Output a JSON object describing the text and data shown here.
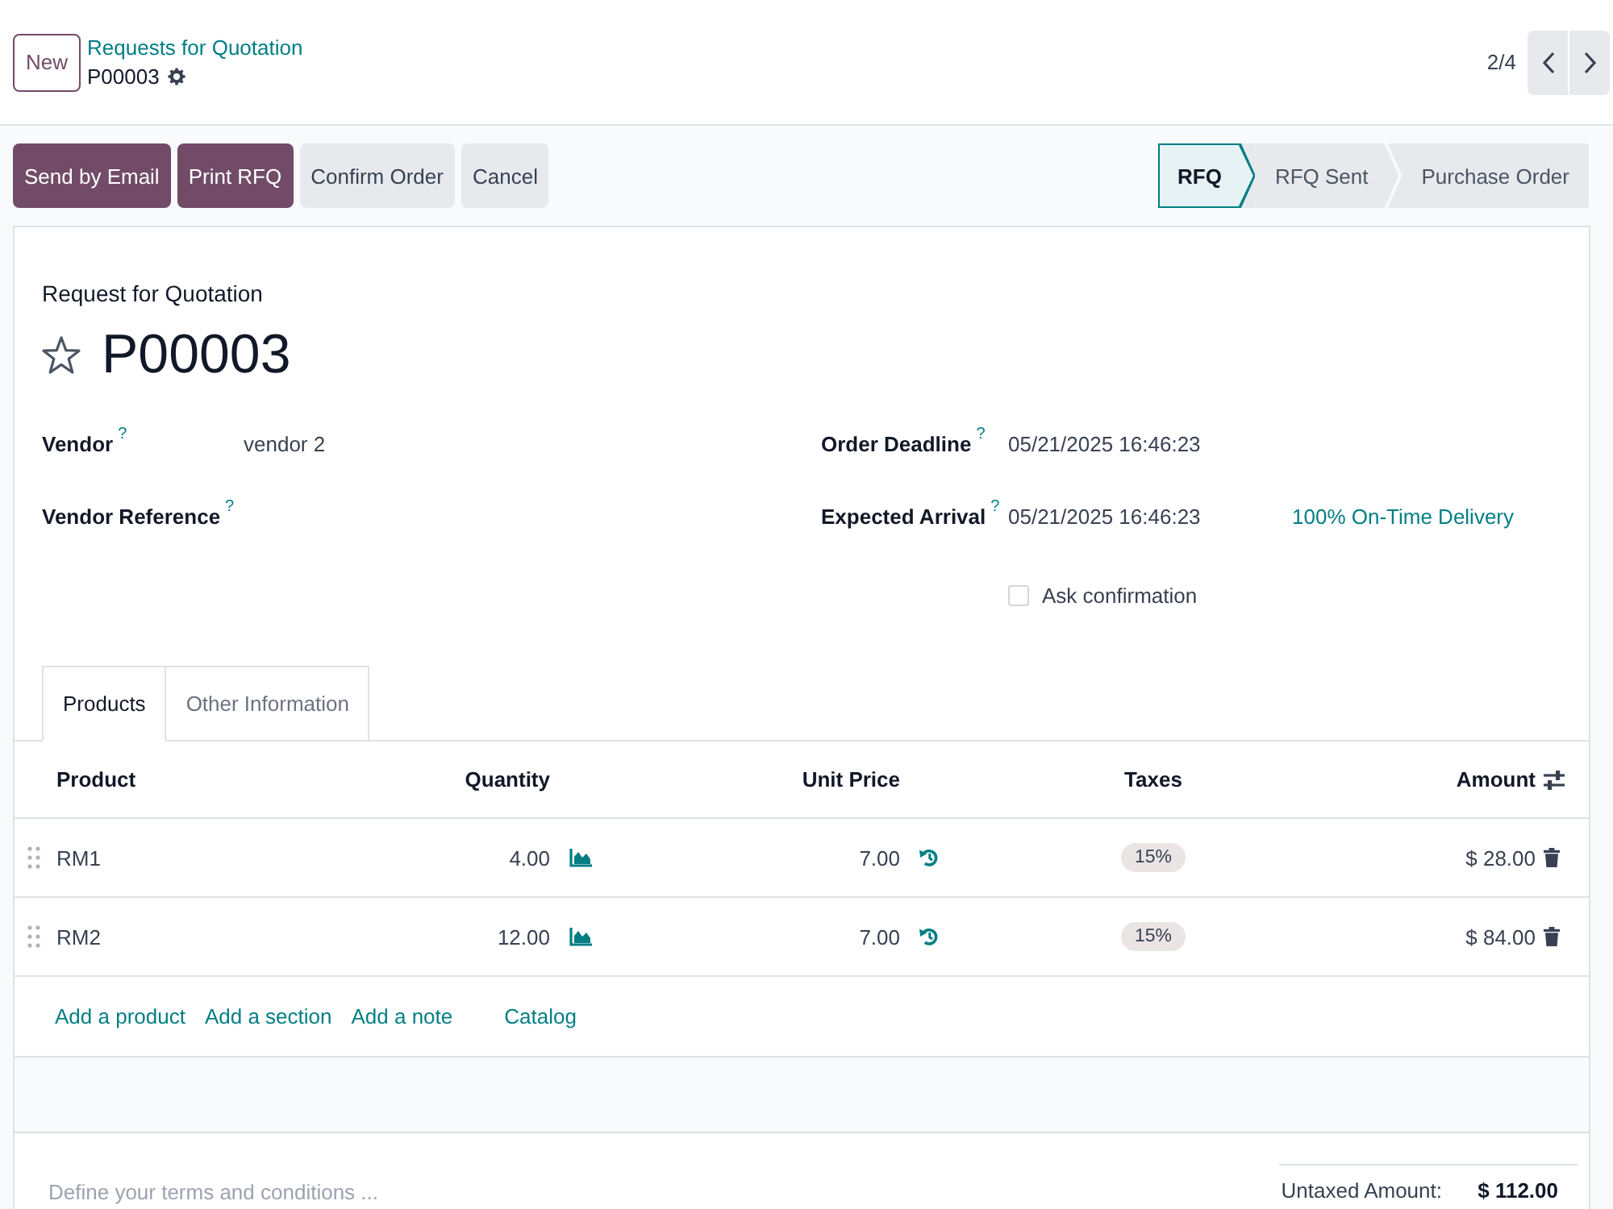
{
  "control_panel": {
    "new_button": "New",
    "breadcrumb": {
      "parent": "Requests for Quotation",
      "current": "P00003"
    },
    "pager": "2/4"
  },
  "action_bar": {
    "buttons": [
      {
        "label": "Send by Email",
        "kind": "primary"
      },
      {
        "label": "Print RFQ",
        "kind": "primary"
      },
      {
        "label": "Confirm Order",
        "kind": "secondary"
      },
      {
        "label": "Cancel",
        "kind": "secondary"
      }
    ],
    "status_steps": [
      {
        "label": "RFQ",
        "selected": true
      },
      {
        "label": "RFQ Sent",
        "selected": false
      },
      {
        "label": "Purchase Order",
        "selected": false
      }
    ]
  },
  "form": {
    "subtitle": "Request for Quotation",
    "title": "P00003",
    "starred": false,
    "left_fields": [
      {
        "label": "Vendor",
        "help": "?",
        "value": "vendor 2"
      },
      {
        "label": "Vendor Reference",
        "help": "?"
      }
    ],
    "right_fields": [
      {
        "label": "Order Deadline",
        "help": "?",
        "value": "05/21/2025 16:46:23"
      },
      {
        "label": "Expected Arrival",
        "help": "?",
        "value": "05/21/2025 16:46:23",
        "note": "100% On-Time Delivery"
      }
    ],
    "ask_confirmation": {
      "label": "Ask confirmation",
      "checked": false
    }
  },
  "notebook": {
    "tabs": [
      {
        "label": "Products",
        "selected": true
      },
      {
        "label": "Other Information",
        "selected": false
      }
    ]
  },
  "table": {
    "columns": [
      "Product",
      "Quantity",
      "Unit Price",
      "Taxes",
      "Amount"
    ],
    "rows": [
      {
        "product": "RM1",
        "quantity": "4.00",
        "unit_price": "7.00",
        "taxes": "15%",
        "amount": "$ 28.00"
      },
      {
        "product": "RM2",
        "quantity": "12.00",
        "unit_price": "7.00",
        "taxes": "15%",
        "amount": "$ 84.00"
      }
    ],
    "add_links": [
      "Add a product",
      "Add a section",
      "Add a note"
    ],
    "catalog_button": "Catalog"
  },
  "footer": {
    "terms": {
      "placeholder": "Define your terms and conditions ..."
    },
    "totals": [
      {
        "label": "Untaxed Amount:",
        "value": "$ 112.00"
      }
    ]
  }
}
